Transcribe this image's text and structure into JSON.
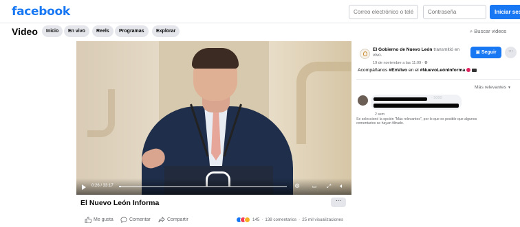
{
  "topbar": {
    "logo": "facebook",
    "email_placeholder": "Correo electrónico o telé",
    "password_placeholder": "Contraseña",
    "login_label": "Iniciar sesión"
  },
  "subnav": {
    "title": "Video",
    "pills": [
      "Inicio",
      "En vivo",
      "Reels",
      "Programas",
      "Explorar"
    ],
    "search_label": "Buscar videos"
  },
  "player": {
    "time": "0:26 / 33:17",
    "progress_fraction": 0.013
  },
  "video": {
    "title": "El Nuevo León Informa",
    "more_label": "···"
  },
  "actions": {
    "like": "Me gusta",
    "comment": "Comentar",
    "share": "Compartir"
  },
  "stats": {
    "reactions_count": "145",
    "comments": "138 comentarios",
    "views": "25 mil visualizaciones",
    "reaction_colors": [
      "#1877f2",
      "#f33e58",
      "#f7b125"
    ]
  },
  "post": {
    "page_name": "El Gobierno de Nuevo León",
    "action_text": "transmitió en vivo.",
    "timestamp": "19 de noviembre a las 11:09 · ",
    "follow_label": "Seguir",
    "more_label": "···",
    "text_prefix": "Acompáñanos",
    "tag1": "#EnVivo",
    "text_mid": "en el",
    "tag2": "#NuevoLeónInforma"
  },
  "comments": {
    "sort_label": "Más relevantes",
    "faded_meta": "· 5000",
    "age": "2 sem",
    "notice": "Se seleccionó la opción \"Más relevantes\", por lo que es posible que algunos comentarios se hayan filtrado."
  }
}
